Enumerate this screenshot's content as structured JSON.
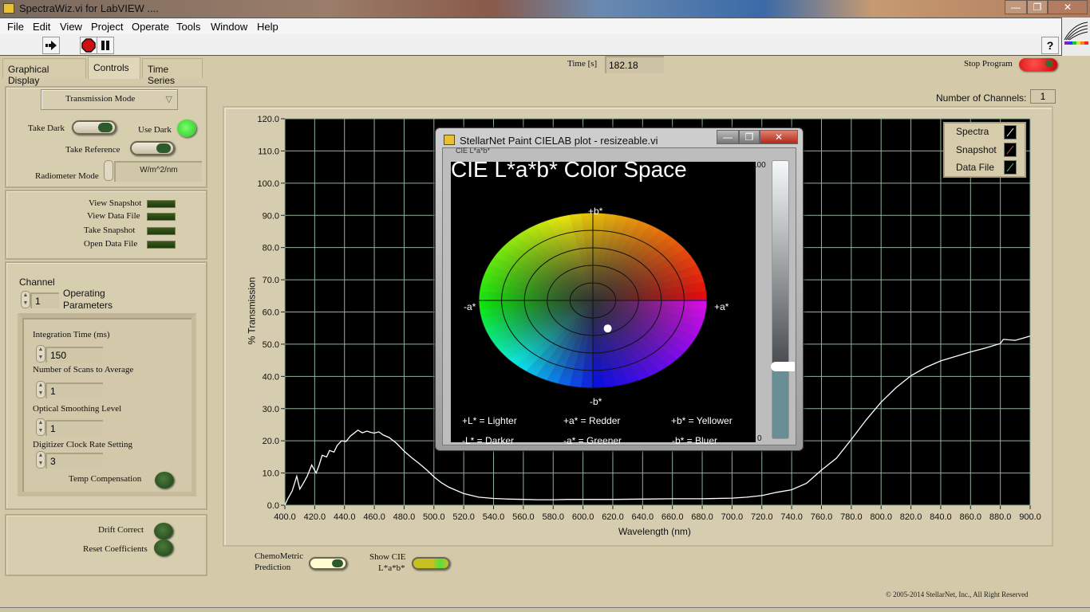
{
  "window": {
    "title": "SpectraWiz.vi for LabVIEW ....",
    "controls": {
      "minimize": "—",
      "maximize": "❐",
      "close": "✕"
    }
  },
  "menu": [
    "File",
    "Edit",
    "View",
    "Project",
    "Operate",
    "Tools",
    "Window",
    "Help"
  ],
  "toolbar": {
    "run_icon": "run-arrow-icon",
    "abort_icon": "abort-stop-icon",
    "pause_icon": "pause-icon",
    "help_label": "?"
  },
  "tabs": [
    {
      "label": "Graphical Display",
      "active": false
    },
    {
      "label": "Controls",
      "active": true
    },
    {
      "label": "Time Series",
      "active": false
    }
  ],
  "header": {
    "time_label": "Time [s]",
    "time_value": "182.18",
    "stop_label": "Stop Program",
    "channels_label": "Number of Channels:",
    "channels_value": "1"
  },
  "left": {
    "mode_select": "Transmission Mode",
    "take_dark": "Take Dark",
    "use_dark": "Use Dark",
    "take_reference": "Take Reference",
    "radiometer_mode": "Radiometer Mode",
    "radiometer_value": "W/m^2/nm",
    "snapshot_buttons": [
      "View Snapshot",
      "View Data File",
      "Take Snapshot",
      "Open Data File"
    ],
    "channel_label": "Channel",
    "channel_value": "1",
    "operating_label": "Operating Parameters",
    "params": [
      {
        "label": "Integration Time (ms)",
        "value": "150"
      },
      {
        "label": "Number of Scans to Average",
        "value": "1"
      },
      {
        "label": "Optical Smoothing Level",
        "value": "1"
      },
      {
        "label": "Digitizer Clock Rate Setting",
        "value": "3"
      }
    ],
    "temp_comp": "Temp  Compensation",
    "drift_correct": "Drift Correct",
    "reset_coeff": "Reset Coefficients"
  },
  "bottom": {
    "chemometric_line1": "ChemoMetric",
    "chemometric_line2": "Prediction",
    "show_cie_line1": "Show CIE",
    "show_cie_line2": "L*a*b*",
    "copyright": "© 2005-2014 StellarNet, Inc.,  All Right Reserved"
  },
  "legend": [
    {
      "label": "Spectra",
      "color": "#ffffff"
    },
    {
      "label": "Snapshot",
      "color": "#d06060"
    },
    {
      "label": "Data File",
      "color": "#60d080"
    }
  ],
  "cielab_dialog": {
    "title": "StellarNet Paint CIELAB plot - resizeable.vi",
    "small_caption": "CIE L*a*b*",
    "heading": "CIE L*a*b* Color Space",
    "axis_labels": {
      "pos_b": "+b*",
      "neg_b": "-b*",
      "neg_a": "-a*",
      "pos_a": "+a*"
    },
    "notes": [
      "+L* = Lighter",
      "+a* = Redder",
      "+b* = Yellower",
      "-L* = Darker",
      "-a* = Greener",
      "-b* = Bluer"
    ],
    "l_scale_max": "100",
    "l_scale_min": "0",
    "l_value_percent": 26,
    "point": {
      "a_fraction": 0.13,
      "b_fraction": -0.32
    }
  },
  "chart_data": {
    "type": "line",
    "title": "",
    "xlabel": "Wavelength (nm)",
    "ylabel": "% Transmission",
    "xlim": [
      400,
      900
    ],
    "ylim": [
      0,
      120
    ],
    "grid": true,
    "legend_position": "top-right",
    "x_ticks": [
      "400.0",
      "420.0",
      "440.0",
      "460.0",
      "480.0",
      "500.0",
      "520.0",
      "540.0",
      "560.0",
      "580.0",
      "600.0",
      "620.0",
      "640.0",
      "660.0",
      "680.0",
      "700.0",
      "720.0",
      "740.0",
      "760.0",
      "780.0",
      "800.0",
      "820.0",
      "840.0",
      "860.0",
      "880.0",
      "900.0"
    ],
    "y_ticks": [
      "0.0",
      "10.0",
      "20.0",
      "30.0",
      "40.0",
      "50.0",
      "60.0",
      "70.0",
      "80.0",
      "90.0",
      "100.0",
      "110.0",
      "120.0"
    ],
    "series": [
      {
        "name": "Spectra",
        "x": [
          400,
          402,
          405,
          408,
          410,
          412,
          415,
          418,
          421,
          423,
          425,
          428,
          430,
          433,
          435,
          438,
          441,
          444,
          446,
          449,
          452,
          455,
          458,
          460,
          463,
          466,
          470,
          475,
          480,
          485,
          490,
          495,
          500,
          505,
          510,
          515,
          520,
          530,
          540,
          550,
          560,
          570,
          580,
          590,
          600,
          620,
          640,
          660,
          680,
          700,
          710,
          720,
          730,
          740,
          750,
          760,
          770,
          780,
          790,
          800,
          810,
          820,
          830,
          840,
          850,
          860,
          870,
          880,
          882,
          890,
          900
        ],
        "y": [
          0,
          2,
          4.5,
          9,
          5,
          6.5,
          9,
          12.5,
          10,
          12.5,
          15.5,
          15,
          17,
          16.5,
          18.5,
          20,
          19.8,
          21.5,
          22.2,
          23.3,
          22.5,
          23,
          22.6,
          22.4,
          22.8,
          21.8,
          21,
          19.2,
          16.8,
          14.8,
          13,
          11,
          8.8,
          7,
          5.6,
          4.6,
          3.6,
          2.5,
          2.1,
          1.9,
          1.8,
          1.7,
          1.7,
          1.8,
          1.8,
          1.8,
          1.9,
          2.0,
          2.0,
          2.2,
          2.5,
          3.0,
          4.0,
          4.8,
          6.8,
          10.9,
          14.6,
          20.4,
          26.5,
          32,
          36.5,
          40.2,
          42.8,
          44.8,
          46.2,
          47.6,
          48.8,
          50.2,
          51.5,
          51.2,
          52.5
        ]
      }
    ]
  }
}
